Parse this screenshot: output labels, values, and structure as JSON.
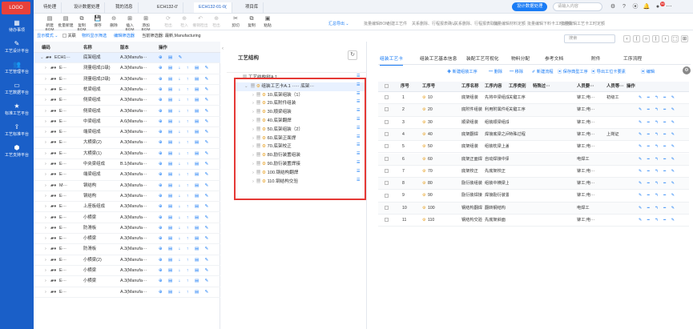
{
  "sidebar": {
    "logo": "LOGO",
    "items": [
      {
        "label": "待办事项",
        "icon": "calendar-icon",
        "glyph": "▦"
      },
      {
        "label": "工艺设计平台",
        "icon": "pen-icon",
        "glyph": "✎"
      },
      {
        "label": "工艺管理平台",
        "icon": "users-icon",
        "glyph": "👥"
      },
      {
        "label": "工艺数据平台",
        "icon": "monitor-icon",
        "glyph": "▭"
      },
      {
        "label": "标准工艺平台",
        "icon": "star-icon",
        "glyph": "★"
      },
      {
        "label": "工艺标准平台",
        "icon": "upload-icon",
        "glyph": "⇪"
      },
      {
        "label": "工艺支持平台",
        "icon": "shield-icon",
        "glyph": "⬢"
      }
    ]
  },
  "topbar": {
    "tabs": [
      "待处理",
      "设计数据处理",
      "我的消息",
      "ECH132-0'",
      "ECH132-01-0(",
      "项目库"
    ],
    "active_tab": 4,
    "design_btn": "设计数据处理",
    "search_placeholder": "请输入内容",
    "icons": [
      "gear-icon",
      "help-icon",
      "record-icon",
      "bell-icon",
      "user-icon",
      "more-icon"
    ],
    "notif_count": "99"
  },
  "toolbar": {
    "buttons": [
      {
        "label": "新建BOM",
        "glyph": "▤",
        "disabled": false
      },
      {
        "label": "批量新建",
        "glyph": "▤",
        "disabled": false
      },
      {
        "label": "复制BOM",
        "glyph": "⧉",
        "disabled": false
      },
      {
        "label": "保存",
        "glyph": "💾",
        "disabled": false
      },
      {
        "label": "删除",
        "glyph": "⊝",
        "disabled": false
      },
      {
        "label": "插入BOM",
        "glyph": "⊞",
        "disabled": false
      },
      {
        "label": "添加BOM",
        "glyph": "⊞",
        "disabled": false
      },
      {
        "label": "检出",
        "glyph": "⟳",
        "disabled": true
      },
      {
        "label": "检入",
        "glyph": "⊕",
        "disabled": true
      },
      {
        "label": "撤销检出",
        "glyph": "↶",
        "disabled": true
      },
      {
        "label": "检出",
        "glyph": "⊕",
        "disabled": true
      },
      {
        "label": "剪切",
        "glyph": "✂",
        "disabled": false
      },
      {
        "label": "复制",
        "glyph": "⧉",
        "disabled": false
      },
      {
        "label": "粘贴",
        "glyph": "▣",
        "disabled": false
      }
    ],
    "import_label": "汇总导出 ⌄",
    "text_actions": [
      "批量编辑BOM",
      "创建工艺件",
      "关系删除、行程报表确认",
      "关系删除、行程报表取消",
      "批量编辑材料定额",
      "批量编辑下料卡工时定额",
      "批量编辑工艺卡工时定额"
    ],
    "search_placeholder": "搜索"
  },
  "filter": {
    "show_mode": "显示模式 ⌄",
    "related": "关联",
    "material_filter": "物料显示筛选",
    "edit_filter": "编辑筛选器",
    "current_filter": "当前筛选器: 最新,Manufacturing"
  },
  "left_table": {
    "headers": [
      "编码",
      "名称",
      "版本",
      "操作"
    ],
    "rows": [
      {
        "code": "ECH1···",
        "name": "底架组成",
        "ver": "A.3(Manufa···",
        "sel": true
      },
      {
        "code": "E···",
        "name": "测量组成(1级)",
        "ver": "A.3(Manufa···"
      },
      {
        "code": "E···",
        "name": "测量组成(2级)",
        "ver": "A.3(Manufa···"
      },
      {
        "code": "E···",
        "name": "枕梁组成",
        "ver": "A.3(Manufa···"
      },
      {
        "code": "E···",
        "name": "侧梁组成",
        "ver": "A.3(Manufa···"
      },
      {
        "code": "E···",
        "name": "侧梁组成",
        "ver": "A.3(Manufa···"
      },
      {
        "code": "E···",
        "name": "中梁组成",
        "ver": "A.6(Manufa···"
      },
      {
        "code": "E···",
        "name": "端梁组成",
        "ver": "A.3(Manufa···"
      },
      {
        "code": "E···",
        "name": "大横梁(2)",
        "ver": "A.3(Manufa···"
      },
      {
        "code": "E···",
        "name": "大横梁(1)",
        "ver": "A.3(Manufa···"
      },
      {
        "code": "E···",
        "name": "中央梁组成",
        "ver": "B.1(Manufa···"
      },
      {
        "code": "E···",
        "name": "端梁组成",
        "ver": "A.3(Manufa···"
      },
      {
        "code": "M···",
        "name": "钢结构",
        "ver": "A.3(Manufa···"
      },
      {
        "code": "E···",
        "name": "钢结构",
        "ver": "A.3(Manufa···"
      },
      {
        "code": "E···",
        "name": "上座板组成",
        "ver": "A.3(Manufa···"
      },
      {
        "code": "E···",
        "name": "小横梁",
        "ver": "A.3(Manufa···"
      },
      {
        "code": "E···",
        "name": "防滑板",
        "ver": "A.3(Manufa···"
      },
      {
        "code": "E···",
        "name": "小横梁",
        "ver": "A.3(Manufa···"
      },
      {
        "code": "E···",
        "name": "防滑板",
        "ver": "A.3(Manufa···"
      },
      {
        "code": "E···",
        "name": "小横梁(2)",
        "ver": "A.3(Manufa···"
      },
      {
        "code": "E···",
        "name": "小横梁",
        "ver": "A.3(Manufa···"
      },
      {
        "code": "E···",
        "name": "小横梁",
        "ver": "A.3(Manufa···"
      },
      {
        "code": "E···",
        "name": "",
        "ver": "A.3(Manufa···"
      }
    ],
    "ops_first": "⊕ ▤ ✎",
    "ops_rest": "⊕ ▤ ↓ ↑ ▤ ✎"
  },
  "mid_panel": {
    "title": "工艺结构",
    "root": "工艺结构树A.1",
    "node": "组装工艺卡A.1 ····· 底架···",
    "children": [
      "10.底架组装（1）",
      "20.底附件组装",
      "30.顺梁组装",
      "40.底架翻焊",
      "50.底架组装（2）",
      "60.底架正面焊",
      "70.底架校正",
      "80.励衍装置组装",
      "90.励衍装置焊接",
      "100.钢结构翻焊",
      "110.钢结构交验"
    ]
  },
  "right_panel": {
    "tabs": [
      "组装工艺卡",
      "组装工艺基本信息",
      "装配工艺可视化",
      "物料分配",
      "参考文档",
      "附件",
      "工序流程"
    ],
    "actions": [
      "✚ 新建组装工序",
      "━ 删除",
      "━ 移除",
      "✐ 新建流程",
      "▣ 保存典型工序",
      "▣ 导出工位卡要素",
      "▣ 编辑"
    ],
    "headers": [
      "序号",
      "工序号",
      "工序名称",
      "工序内容",
      "工序类别",
      "特殊过···",
      "人员要···",
      "人员等···",
      "操作"
    ],
    "rows": [
      {
        "seq": "1",
        "op": "10",
        "name": "底架组装",
        "content": "先将中梁组成",
        "type": "关键工序",
        "special": "",
        "staff": "铆工;电···",
        "level": "初级工"
      },
      {
        "seq": "2",
        "op": "20",
        "name": "底附件组装",
        "content": "利用附属件组",
        "type": "关键工序",
        "special": "",
        "staff": "铆工;电···",
        "level": ""
      },
      {
        "seq": "3",
        "op": "30",
        "name": "顺梁组装",
        "content": "组装顺梁组成",
        "type": "",
        "special": "",
        "staff": "铆工;电···",
        "level": ""
      },
      {
        "seq": "4",
        "op": "40",
        "name": "底架翻焊",
        "content": "焊接底梁之间",
        "type": "特殊过程",
        "special": "",
        "staff": "铆工;电···",
        "level": "上岗证"
      },
      {
        "seq": "5",
        "op": "50",
        "name": "底架组装",
        "content": "组装枕梁上盖",
        "type": "",
        "special": "",
        "staff": "铆工;电···",
        "level": ""
      },
      {
        "seq": "6",
        "op": "60",
        "name": "底架正面焊",
        "content": "自动焊接中梁",
        "type": "",
        "special": "",
        "staff": "电焊工",
        "level": ""
      },
      {
        "seq": "7",
        "op": "70",
        "name": "底架校正",
        "content": "先底架校正",
        "type": "",
        "special": "",
        "staff": "铆工;电···",
        "level": ""
      },
      {
        "seq": "8",
        "op": "80",
        "name": "励衍装组装",
        "content": "组装中横梁上",
        "type": "",
        "special": "",
        "staff": "铆工;电···",
        "level": ""
      },
      {
        "seq": "9",
        "op": "90",
        "name": "励衍装焊接",
        "content": "焊接励衍装置",
        "type": "",
        "special": "",
        "staff": "铆工;电···",
        "level": ""
      },
      {
        "seq": "10",
        "op": "100",
        "name": "钢结构翻焊",
        "content": "翻转钢结构",
        "type": "",
        "special": "",
        "staff": "电焊工",
        "level": ""
      },
      {
        "seq": "11",
        "op": "110",
        "name": "钢结构交验",
        "content": "先底架斜面",
        "type": "",
        "special": "",
        "staff": "铆工;电···",
        "level": ""
      }
    ],
    "row_ops": "✎ ━ ↰ ━ ✎"
  },
  "colors": {
    "brand": "#1a5fc8",
    "accent": "#1a7cf5",
    "highlight": "#e53935",
    "gear": "#e8a020"
  }
}
